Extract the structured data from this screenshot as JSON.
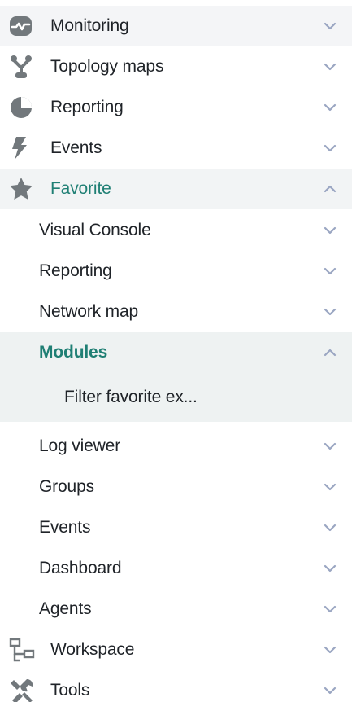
{
  "menu": {
    "items": [
      {
        "id": "monitoring",
        "label": "Monitoring",
        "icon": "monitoring-icon",
        "expanded": false
      },
      {
        "id": "topology",
        "label": "Topology maps",
        "icon": "topology-icon",
        "expanded": false
      },
      {
        "id": "reporting",
        "label": "Reporting",
        "icon": "reporting-icon",
        "expanded": false
      },
      {
        "id": "events",
        "label": "Events",
        "icon": "events-icon",
        "expanded": false
      },
      {
        "id": "favorite",
        "label": "Favorite",
        "icon": "star-icon",
        "expanded": true
      },
      {
        "id": "workspace",
        "label": "Workspace",
        "icon": "workspace-icon",
        "expanded": false
      },
      {
        "id": "tools",
        "label": "Tools",
        "icon": "tools-icon",
        "expanded": false
      }
    ],
    "favorite_children": [
      {
        "label": "Visual Console",
        "expanded": false
      },
      {
        "label": "Reporting",
        "expanded": false
      },
      {
        "label": "Network map",
        "expanded": false
      },
      {
        "label": "Modules",
        "expanded": true
      },
      {
        "label": "Log viewer",
        "expanded": false
      },
      {
        "label": "Groups",
        "expanded": false
      },
      {
        "label": "Events",
        "expanded": false
      },
      {
        "label": "Dashboard",
        "expanded": false
      },
      {
        "label": "Agents",
        "expanded": false
      }
    ],
    "modules_children": [
      {
        "label": "Filter favorite ex..."
      }
    ]
  },
  "colors": {
    "icon": "#72787c",
    "active": "#1f7f74",
    "chevron": "#9aa6c2",
    "background_light": "#f4f5f7",
    "background_favorite": "#f2f4f5",
    "background_modules": "#eef2f2"
  }
}
